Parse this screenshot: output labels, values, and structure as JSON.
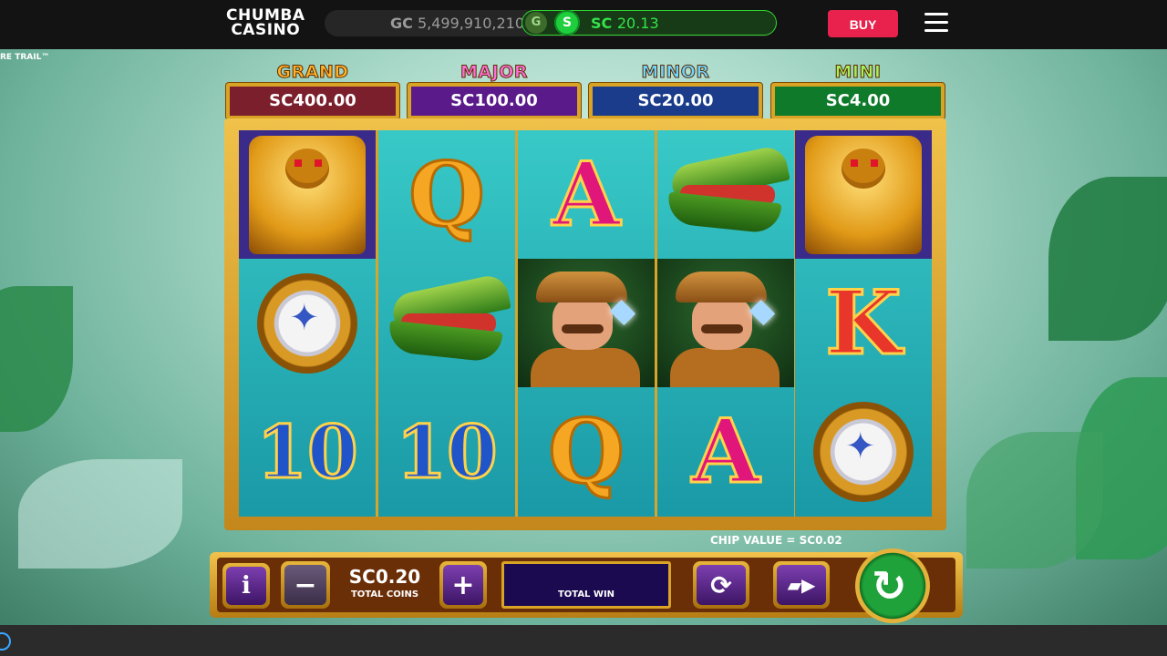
{
  "header": {
    "logo_line1": "CHUMBA",
    "logo_line2": "CASINO",
    "gc_label": "GC",
    "gc_value": "5,499,910,210",
    "gc_toggle_letter": "G",
    "sc_toggle_letter": "S",
    "sc_label": "SC",
    "sc_value": "20.13",
    "buy_label": "BUY"
  },
  "game": {
    "title_fragment": "RE TRAIL™",
    "jackpots": [
      {
        "name": "GRAND",
        "value": "SC400.00",
        "title_color": "#ffb229",
        "box_color": "#7b1f2c"
      },
      {
        "name": "MAJOR",
        "value": "SC100.00",
        "title_color": "#ff6fd8",
        "box_color": "#5a1a8a"
      },
      {
        "name": "MINOR",
        "value": "SC20.00",
        "title_color": "#6fd6ff",
        "box_color": "#1a3c8a"
      },
      {
        "name": "MINI",
        "value": "SC4.00",
        "title_color": "#a6f05a",
        "box_color": "#0f7a2a"
      }
    ],
    "reels": [
      [
        "idol-icon",
        "compass-icon",
        "ten-symbol"
      ],
      [
        "queen-symbol",
        "crocodile-icon",
        "ten-symbol"
      ],
      [
        "ace-symbol",
        "explorer-icon",
        "queen-symbol"
      ],
      [
        "crocodile-icon",
        "explorer-icon",
        "ace-symbol"
      ],
      [
        "idol-icon",
        "king-symbol",
        "compass-icon"
      ]
    ],
    "letters": {
      "ten": "10",
      "queen": "Q",
      "ace": "A",
      "king": "K"
    },
    "chip_value": "CHIP VALUE = SC0.02",
    "info_label": "i",
    "minus_label": "−",
    "plus_label": "+",
    "total_coins_value": "SC0.20",
    "total_coins_label": "TOTAL COINS",
    "total_win_value": "",
    "total_win_label": "TOTAL WIN"
  }
}
